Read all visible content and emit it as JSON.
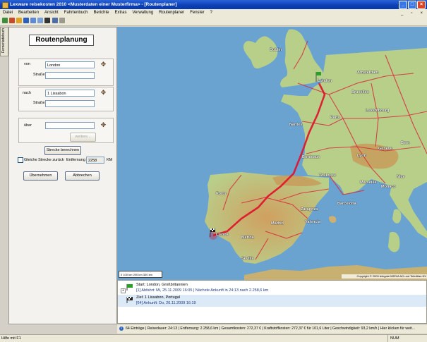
{
  "window": {
    "title": "Lexware reisekosten 2010 <Musterdaten einer Musterfirma> - [Routenplaner]"
  },
  "menu": {
    "items": [
      "Datei",
      "Bearbeiten",
      "Ansicht",
      "Fahrtenbuch",
      "Berichte",
      "Extras",
      "Verwaltung",
      "Routenplaner",
      "Fenster",
      "?"
    ]
  },
  "sidetab": {
    "label": "Fernerladebuch"
  },
  "panel": {
    "heading": "Routenplanung",
    "from": {
      "label": "von",
      "value": "London",
      "street_label": "Straße",
      "street_value": ""
    },
    "to": {
      "label": "nach",
      "value": "1 Lissabon",
      "street_label": "Straße",
      "street_value": ""
    },
    "via": {
      "label": "über",
      "value": "",
      "more_label": "weitere..."
    },
    "calc_button": "Strecke berechnen",
    "same_route_label": "Gleiche Strecke zurück",
    "distance_label": "Entfernung",
    "distance_value": "2258",
    "distance_unit": "KM",
    "accept_button": "Übernehmen",
    "cancel_button": "Abbrechen"
  },
  "map": {
    "cities": [
      "Dublin",
      "London",
      "Amsterdam",
      "Bruxelles",
      "Luxembourg",
      "Paris",
      "Bern",
      "Monaco",
      "Lisboa",
      "Madrid",
      "Sevilla",
      "Valencia",
      "Barcelona",
      "Porto",
      "Bordeaux",
      "Lyon",
      "Marseille",
      "Nantes",
      "Zaragoza",
      "Toulouse",
      "Nice",
      "Genève",
      "Mérida"
    ],
    "scale": "0    100 km   200 km  300 km",
    "copyright": "Copyright © 2009 telegate MEDIA AG und TeleAtlas NV"
  },
  "stages": [
    {
      "title": "Start: London, Großbritannien",
      "detail": "[1] Abfahrt: Mi, 25.11.2009 16:05 | Nächste Ankunft in 24:13 nach 2.258,6 km"
    },
    {
      "title": "Ziel: 1 Lissabon, Portugal",
      "detail": "[64] Ankunft: Do, 26.11.2009 16:19"
    }
  ],
  "summary": {
    "text": "64 Einträge | Reisedauer: 24:13 | Entfernung: 2.258,6 km | Gesamtkosten: 272,37 € | Kraftstoffkosten: 272,37 € für 101,6 Liter | Geschwindigkeit: 93,2 km/h | Hier klicken für weit..."
  },
  "statusbar": {
    "left": "Hilfe mit F1",
    "num": "NUM"
  },
  "colors": {
    "sea": "#6aa3cf",
    "land": "#b8cf8a",
    "mountain": "#c89858",
    "road": "#d9283a",
    "route": "#e0102a",
    "titlebar": "#0b3fb5"
  }
}
